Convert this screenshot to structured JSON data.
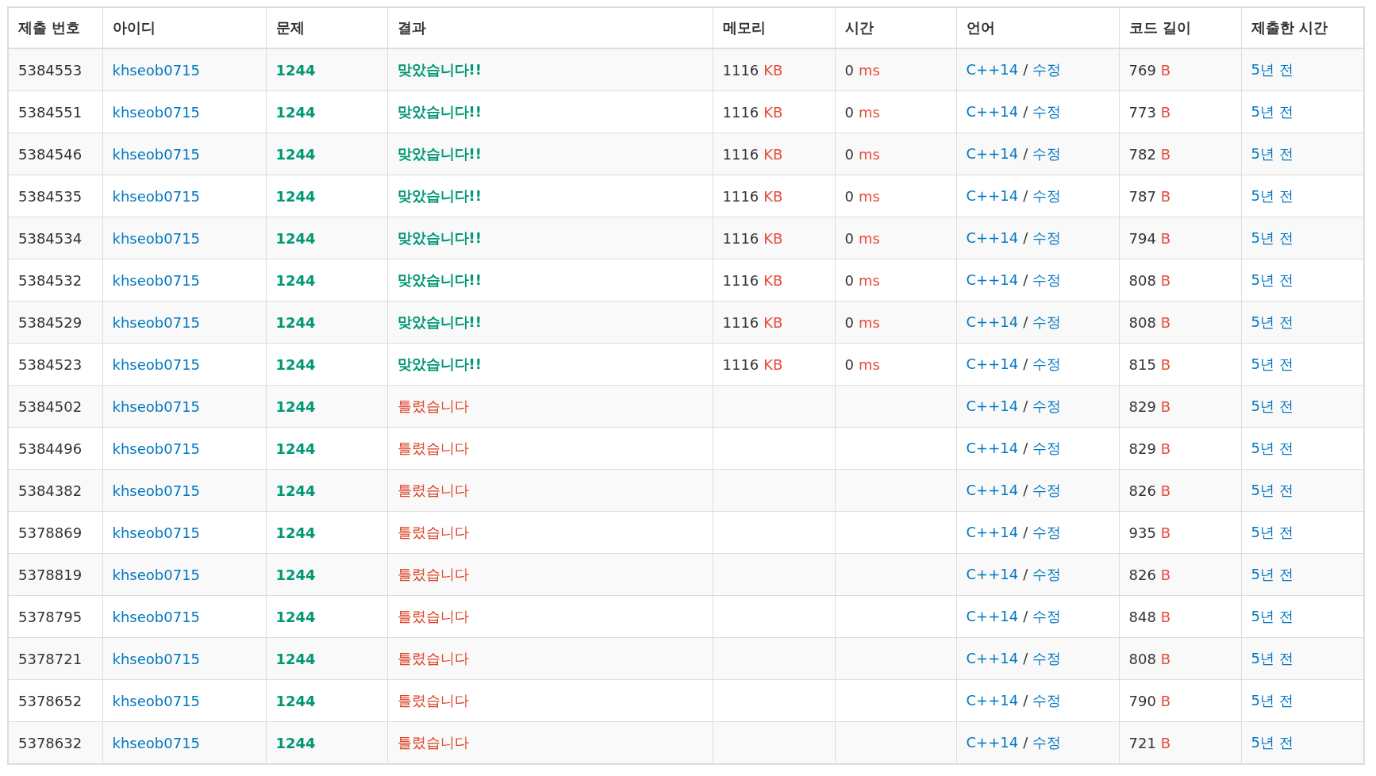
{
  "columns": [
    "제출 번호",
    "아이디",
    "문제",
    "결과",
    "메모리",
    "시간",
    "언어",
    "코드 길이",
    "제출한 시간"
  ],
  "rows": [
    {
      "id": "5384553",
      "user": "khseob0715",
      "problem": "1244",
      "result": "맞았습니다!!",
      "kind": "accepted",
      "memory": "1116",
      "memory_unit": "KB",
      "time": "0",
      "time_unit": "ms",
      "language": "C++14",
      "sep": "/",
      "edit": "수정",
      "length": "769",
      "length_unit": "B",
      "submitted": "5년 전"
    },
    {
      "id": "5384551",
      "user": "khseob0715",
      "problem": "1244",
      "result": "맞았습니다!!",
      "kind": "accepted",
      "memory": "1116",
      "memory_unit": "KB",
      "time": "0",
      "time_unit": "ms",
      "language": "C++14",
      "sep": "/",
      "edit": "수정",
      "length": "773",
      "length_unit": "B",
      "submitted": "5년 전"
    },
    {
      "id": "5384546",
      "user": "khseob0715",
      "problem": "1244",
      "result": "맞았습니다!!",
      "kind": "accepted",
      "memory": "1116",
      "memory_unit": "KB",
      "time": "0",
      "time_unit": "ms",
      "language": "C++14",
      "sep": "/",
      "edit": "수정",
      "length": "782",
      "length_unit": "B",
      "submitted": "5년 전"
    },
    {
      "id": "5384535",
      "user": "khseob0715",
      "problem": "1244",
      "result": "맞았습니다!!",
      "kind": "accepted",
      "memory": "1116",
      "memory_unit": "KB",
      "time": "0",
      "time_unit": "ms",
      "language": "C++14",
      "sep": "/",
      "edit": "수정",
      "length": "787",
      "length_unit": "B",
      "submitted": "5년 전"
    },
    {
      "id": "5384534",
      "user": "khseob0715",
      "problem": "1244",
      "result": "맞았습니다!!",
      "kind": "accepted",
      "memory": "1116",
      "memory_unit": "KB",
      "time": "0",
      "time_unit": "ms",
      "language": "C++14",
      "sep": "/",
      "edit": "수정",
      "length": "794",
      "length_unit": "B",
      "submitted": "5년 전"
    },
    {
      "id": "5384532",
      "user": "khseob0715",
      "problem": "1244",
      "result": "맞았습니다!!",
      "kind": "accepted",
      "memory": "1116",
      "memory_unit": "KB",
      "time": "0",
      "time_unit": "ms",
      "language": "C++14",
      "sep": "/",
      "edit": "수정",
      "length": "808",
      "length_unit": "B",
      "submitted": "5년 전"
    },
    {
      "id": "5384529",
      "user": "khseob0715",
      "problem": "1244",
      "result": "맞았습니다!!",
      "kind": "accepted",
      "memory": "1116",
      "memory_unit": "KB",
      "time": "0",
      "time_unit": "ms",
      "language": "C++14",
      "sep": "/",
      "edit": "수정",
      "length": "808",
      "length_unit": "B",
      "submitted": "5년 전"
    },
    {
      "id": "5384523",
      "user": "khseob0715",
      "problem": "1244",
      "result": "맞았습니다!!",
      "kind": "accepted",
      "memory": "1116",
      "memory_unit": "KB",
      "time": "0",
      "time_unit": "ms",
      "language": "C++14",
      "sep": "/",
      "edit": "수정",
      "length": "815",
      "length_unit": "B",
      "submitted": "5년 전"
    },
    {
      "id": "5384502",
      "user": "khseob0715",
      "problem": "1244",
      "result": "틀렸습니다",
      "kind": "wrong",
      "language": "C++14",
      "sep": "/",
      "edit": "수정",
      "length": "829",
      "length_unit": "B",
      "submitted": "5년 전"
    },
    {
      "id": "5384496",
      "user": "khseob0715",
      "problem": "1244",
      "result": "틀렸습니다",
      "kind": "wrong",
      "language": "C++14",
      "sep": "/",
      "edit": "수정",
      "length": "829",
      "length_unit": "B",
      "submitted": "5년 전"
    },
    {
      "id": "5384382",
      "user": "khseob0715",
      "problem": "1244",
      "result": "틀렸습니다",
      "kind": "wrong",
      "language": "C++14",
      "sep": "/",
      "edit": "수정",
      "length": "826",
      "length_unit": "B",
      "submitted": "5년 전"
    },
    {
      "id": "5378869",
      "user": "khseob0715",
      "problem": "1244",
      "result": "틀렸습니다",
      "kind": "wrong",
      "language": "C++14",
      "sep": "/",
      "edit": "수정",
      "length": "935",
      "length_unit": "B",
      "submitted": "5년 전"
    },
    {
      "id": "5378819",
      "user": "khseob0715",
      "problem": "1244",
      "result": "틀렸습니다",
      "kind": "wrong",
      "language": "C++14",
      "sep": "/",
      "edit": "수정",
      "length": "826",
      "length_unit": "B",
      "submitted": "5년 전"
    },
    {
      "id": "5378795",
      "user": "khseob0715",
      "problem": "1244",
      "result": "틀렸습니다",
      "kind": "wrong",
      "language": "C++14",
      "sep": "/",
      "edit": "수정",
      "length": "848",
      "length_unit": "B",
      "submitted": "5년 전"
    },
    {
      "id": "5378721",
      "user": "khseob0715",
      "problem": "1244",
      "result": "틀렸습니다",
      "kind": "wrong",
      "language": "C++14",
      "sep": "/",
      "edit": "수정",
      "length": "808",
      "length_unit": "B",
      "submitted": "5년 전"
    },
    {
      "id": "5378652",
      "user": "khseob0715",
      "problem": "1244",
      "result": "틀렸습니다",
      "kind": "wrong",
      "language": "C++14",
      "sep": "/",
      "edit": "수정",
      "length": "790",
      "length_unit": "B",
      "submitted": "5년 전"
    },
    {
      "id": "5378632",
      "user": "khseob0715",
      "problem": "1244",
      "result": "틀렸습니다",
      "kind": "wrong",
      "language": "C++14",
      "sep": "/",
      "edit": "수정",
      "length": "721",
      "length_unit": "B",
      "submitted": "5년 전"
    }
  ]
}
